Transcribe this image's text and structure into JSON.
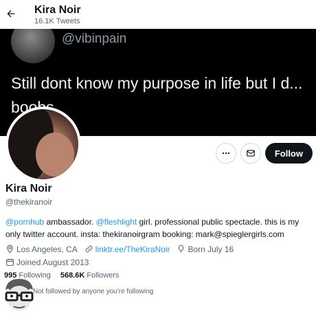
{
  "header": {
    "title": "Kira Noir",
    "tweet_count": "16.1K Tweets"
  },
  "banner": {
    "handle": "@vibinpain",
    "text": "Still dont know my purpose in life but I d... boobs"
  },
  "profile": {
    "name": "Kira Noir",
    "handle": "@thekiranoir",
    "bio": {
      "mention1": "@pornhub",
      "part1": " ambassador. ",
      "mention2": "@fleshlight",
      "part2": " girl. professional public spectacle. this is my only twitter account. insta: thekiranoirgram booking: mark@spieglergirls.com"
    },
    "location": "Los Angeles, CA",
    "website": "linktr.ee/TheKiraNoir",
    "birthday": "Born July 16",
    "joined": "Joined August 2013",
    "following_count": "995",
    "following_label": "Following",
    "followers_count": "568.6K",
    "followers_label": "Followers",
    "followed_by": "Not followed by anyone you're following"
  },
  "actions": {
    "more_icon": "more-icon",
    "message_icon": "envelope-icon",
    "follow_label": "Follow"
  },
  "colors": {
    "accent": "#1d9bf0",
    "text": "#0f1419",
    "secondary": "#536471",
    "banner_bg": "#000000"
  }
}
